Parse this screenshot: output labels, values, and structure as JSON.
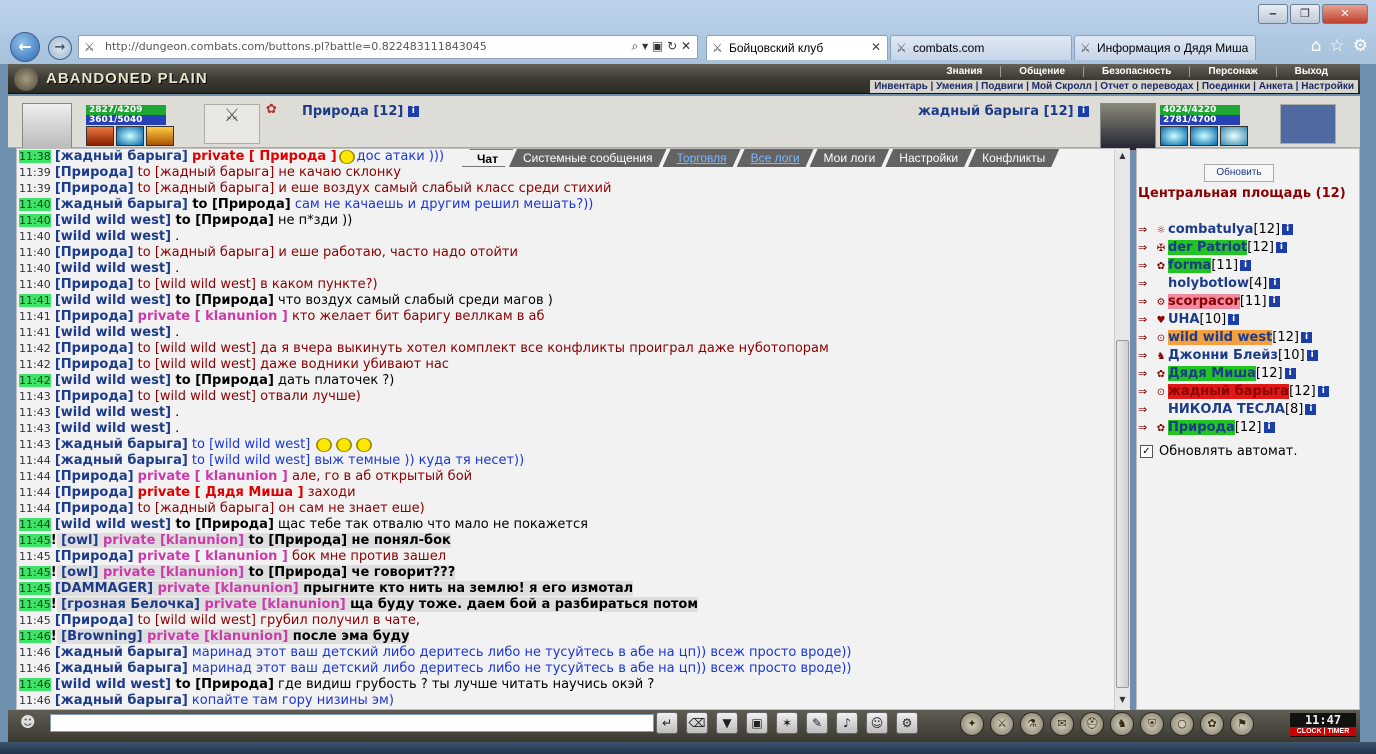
{
  "browser": {
    "url": "http://dungeon.combats.com/buttons.pl?battle=0.822483111843045",
    "tabs": [
      {
        "label": "Бойцовский клуб",
        "close": "✕"
      },
      {
        "label": "combats.com",
        "close": ""
      },
      {
        "label": "Информация о Дядя Миша",
        "close": ""
      }
    ],
    "window_buttons": [
      "‒",
      "❐",
      "✕"
    ]
  },
  "game": {
    "location_banner": "ABANDONED PLAIN",
    "top_menu": [
      "Знания",
      "Общение",
      "Безопасность",
      "Персонаж",
      "Выход"
    ],
    "sub_menu": "Инвентарь | Умения | Подвиги | Мой Скролл | Отчет о переводах | Поединки | Анкета | Настройки",
    "left_player": {
      "name": "Природа [12]",
      "hp": "2827/4209",
      "mana": "3601/5040"
    },
    "right_player": {
      "name": "жадный барыга [12]",
      "hp": "4024/4220",
      "mana": "2781/4700"
    }
  },
  "chat_tabs": [
    "Чат",
    "Системные сообщения",
    "Торговля",
    "Все логи",
    "Мои логи",
    "Настройки",
    "Конфликты"
  ],
  "chat": [
    {
      "ts": "11:38",
      "hl": true,
      "parts": [
        [
          "b",
          "[жадный барыга]"
        ],
        [
          "sp",
          " "
        ],
        [
          "pvr",
          "private [ Природа ]"
        ],
        [
          "sm",
          ""
        ],
        [
          "blue",
          "дос атаки )))"
        ]
      ]
    },
    {
      "ts": "11:39",
      "hl": false,
      "parts": [
        [
          "b",
          "[Природа]"
        ],
        [
          "to",
          " to [жадный барыга]"
        ],
        [
          "t",
          " не качаю склонку"
        ]
      ]
    },
    {
      "ts": "11:39",
      "hl": false,
      "parts": [
        [
          "b",
          "[Природа]"
        ],
        [
          "to",
          " to [жадный барыга]"
        ],
        [
          "t",
          " и еше воздух самый слабый класс среди стихий"
        ]
      ]
    },
    {
      "ts": "11:40",
      "hl": true,
      "parts": [
        [
          "b",
          "[жадный барыга]"
        ],
        [
          "bb",
          " to [Природа]"
        ],
        [
          "blue",
          " сам не качаешь и другим решил мешать?))"
        ]
      ]
    },
    {
      "ts": "11:40",
      "hl": true,
      "parts": [
        [
          "b",
          "[wild wild west]"
        ],
        [
          "bb",
          " to [Природа]"
        ],
        [
          "k",
          " не п*зди ))"
        ]
      ]
    },
    {
      "ts": "11:40",
      "hl": false,
      "parts": [
        [
          "b",
          "[wild wild west]"
        ],
        [
          "k",
          " ."
        ]
      ]
    },
    {
      "ts": "11:40",
      "hl": false,
      "parts": [
        [
          "b",
          "[Природа]"
        ],
        [
          "to",
          " to [жадный барыга]"
        ],
        [
          "t",
          " и еше работаю, часто надо отойти"
        ]
      ]
    },
    {
      "ts": "11:40",
      "hl": false,
      "parts": [
        [
          "b",
          "[wild wild west]"
        ],
        [
          "k",
          " ."
        ]
      ]
    },
    {
      "ts": "11:40",
      "hl": false,
      "parts": [
        [
          "b",
          "[Природа]"
        ],
        [
          "to",
          " to [wild wild west]"
        ],
        [
          "t",
          " в каком пункте?)"
        ]
      ]
    },
    {
      "ts": "11:41",
      "hl": true,
      "parts": [
        [
          "b",
          "[wild wild west]"
        ],
        [
          "bb",
          " to [Природа]"
        ],
        [
          "k",
          " что воздух самый слабый среди магов )"
        ]
      ]
    },
    {
      "ts": "11:41",
      "hl": false,
      "parts": [
        [
          "b",
          "[Природа]"
        ],
        [
          "sp",
          " "
        ],
        [
          "pv",
          "private [ klanunion ]"
        ],
        [
          "t",
          " кто желает бит баригу веллкам в аб"
        ]
      ]
    },
    {
      "ts": "11:41",
      "hl": false,
      "parts": [
        [
          "b",
          "[wild wild west]"
        ],
        [
          "k",
          " ."
        ]
      ]
    },
    {
      "ts": "11:42",
      "hl": false,
      "parts": [
        [
          "b",
          "[Природа]"
        ],
        [
          "to",
          " to [wild wild west]"
        ],
        [
          "t",
          " да я вчера выкинуть хотел комплект все конфликты проиграл даже нуботопорам"
        ]
      ]
    },
    {
      "ts": "11:42",
      "hl": false,
      "parts": [
        [
          "b",
          "[Природа]"
        ],
        [
          "to",
          " to [wild wild west]"
        ],
        [
          "t",
          " даже водники убивают нас"
        ]
      ]
    },
    {
      "ts": "11:42",
      "hl": true,
      "parts": [
        [
          "b",
          "[wild wild west]"
        ],
        [
          "bb",
          " to [Природа]"
        ],
        [
          "k",
          " дать платочек ?)"
        ]
      ]
    },
    {
      "ts": "11:43",
      "hl": false,
      "parts": [
        [
          "b",
          "[Природа]"
        ],
        [
          "to",
          " to [wild wild west]"
        ],
        [
          "t",
          " отвали лучше)"
        ]
      ]
    },
    {
      "ts": "11:43",
      "hl": false,
      "parts": [
        [
          "b",
          "[wild wild west]"
        ],
        [
          "k",
          " ."
        ]
      ]
    },
    {
      "ts": "11:43",
      "hl": false,
      "parts": [
        [
          "b",
          "[wild wild west]"
        ],
        [
          "k",
          " ."
        ]
      ]
    },
    {
      "ts": "11:43",
      "hl": false,
      "parts": [
        [
          "b",
          "[жадный барыга]"
        ],
        [
          "blue",
          " to [wild wild west] "
        ],
        [
          "sm",
          ""
        ],
        [
          "sm",
          ""
        ],
        [
          "sm",
          ""
        ]
      ]
    },
    {
      "ts": "11:44",
      "hl": false,
      "parts": [
        [
          "b",
          "[жадный барыга]"
        ],
        [
          "blue",
          " to [wild wild west] выж темные )) куда тя несет))"
        ]
      ]
    },
    {
      "ts": "11:44",
      "hl": false,
      "parts": [
        [
          "b",
          "[Природа]"
        ],
        [
          "sp",
          " "
        ],
        [
          "pv",
          "private [ klanunion ]"
        ],
        [
          "t",
          " але, го в аб открытый бой"
        ]
      ]
    },
    {
      "ts": "11:44",
      "hl": false,
      "parts": [
        [
          "b",
          "[Природа]"
        ],
        [
          "sp",
          " "
        ],
        [
          "pvr",
          "private [ Дядя Миша ]"
        ],
        [
          "t",
          " заходи"
        ]
      ]
    },
    {
      "ts": "11:44",
      "hl": false,
      "parts": [
        [
          "b",
          "[Природа]"
        ],
        [
          "to",
          " to [жадный барыга]"
        ],
        [
          "t",
          " он сам не знает еше)"
        ]
      ]
    },
    {
      "ts": "11:44",
      "hl": true,
      "parts": [
        [
          "b",
          "[wild wild west]"
        ],
        [
          "bb",
          " to [Природа]"
        ],
        [
          "k",
          " щас тебе так отвалю что мало не покажется"
        ]
      ]
    },
    {
      "ts": "11:45",
      "hl": true,
      "ex": "!",
      "parts": [
        [
          "gb",
          " [owl]"
        ],
        [
          "gpv",
          " private [klanunion]"
        ],
        [
          "gk",
          " to [Природа] не понял-бок"
        ]
      ]
    },
    {
      "ts": "11:45",
      "hl": false,
      "parts": [
        [
          "b",
          "[Природа]"
        ],
        [
          "sp",
          " "
        ],
        [
          "pv",
          "private [ klanunion ]"
        ],
        [
          "t",
          " бок мне против зашел"
        ]
      ]
    },
    {
      "ts": "11:45",
      "hl": true,
      "ex": "!",
      "parts": [
        [
          "gb",
          " [owl]"
        ],
        [
          "gpv",
          " private [klanunion]"
        ],
        [
          "gk",
          " to [Природа] че говорит???"
        ]
      ]
    },
    {
      "ts": "11:45",
      "hl": true,
      "parts": [
        [
          "gb",
          "[DAMMAGER]"
        ],
        [
          "gpv",
          " private [klanunion]"
        ],
        [
          "gk",
          " прыгните кто нить на землю! я его измотал"
        ]
      ]
    },
    {
      "ts": "11:45",
      "hl": true,
      "ex": "!",
      "parts": [
        [
          "gb",
          " [грозная Белочка]"
        ],
        [
          "gpv",
          " private [klanunion]"
        ],
        [
          "gk",
          " ща буду тоже. даем бой а разбираться потом"
        ]
      ]
    },
    {
      "ts": "11:45",
      "hl": false,
      "parts": [
        [
          "b",
          "[Природа]"
        ],
        [
          "to",
          " to [wild wild west]"
        ],
        [
          "t",
          " грубил получил в чате,"
        ]
      ]
    },
    {
      "ts": "11:46",
      "hl": true,
      "ex": "!",
      "parts": [
        [
          "gb",
          " [Browning]"
        ],
        [
          "gpv",
          " private [klanunion]"
        ],
        [
          "gk",
          " после эма буду"
        ]
      ]
    },
    {
      "ts": "11:46",
      "hl": false,
      "parts": [
        [
          "b",
          "[жадный барыга]"
        ],
        [
          "blue",
          " маринад этот ваш детский либо деритесь либо не тусуйтесь в абе на цп)) всеж просто вроде))"
        ]
      ]
    },
    {
      "ts": "11:46",
      "hl": false,
      "parts": [
        [
          "b",
          "[жадный барыга]"
        ],
        [
          "blue",
          " маринад этот ваш детский либо деритесь либо не тусуйтесь в абе на цп)) всеж просто вроде))"
        ]
      ]
    },
    {
      "ts": "11:46",
      "hl": true,
      "parts": [
        [
          "b",
          "[wild wild west]"
        ],
        [
          "bb",
          " to [Природа]"
        ],
        [
          "k",
          " где видиш грубость ? ты лучше читать научись окэй ?"
        ]
      ]
    },
    {
      "ts": "11:46",
      "hl": false,
      "parts": [
        [
          "b",
          "[жадный барыга]"
        ],
        [
          "blue",
          " копайте там гору низины эм)"
        ]
      ]
    }
  ],
  "right_panel": {
    "refresh_label": "Обновить",
    "location": "Центральная площадь (12)",
    "users": [
      {
        "name": "combatulya",
        "level": "[12]",
        "style": ""
      },
      {
        "name": "der Patriot",
        "level": "[12]",
        "style": "green"
      },
      {
        "name": "forma",
        "level": "[11]",
        "style": "green"
      },
      {
        "name": "holybotlow",
        "level": "[4]",
        "style": ""
      },
      {
        "name": "scorpacor",
        "level": "[11]",
        "style": "pink"
      },
      {
        "name": "UHA",
        "level": "[10]",
        "style": ""
      },
      {
        "name": "wild wild west",
        "level": "[12]",
        "style": "orange"
      },
      {
        "name": "Джонни Блейз",
        "level": "[10]",
        "style": ""
      },
      {
        "name": "Дядя Миша",
        "level": "[12]",
        "style": "green"
      },
      {
        "name": "жадный барыга",
        "level": "[12]",
        "style": "red"
      },
      {
        "name": "НИКОЛА ТЕСЛА",
        "level": "[8]",
        "style": ""
      },
      {
        "name": "Природа",
        "level": "[12]",
        "style": "green"
      }
    ],
    "auto_refresh_label": "Обновлять автомат."
  },
  "clock": {
    "time": "11:47",
    "label": "CLOCK | TIMER"
  },
  "colors": {
    "highlight_ts": "#3fe36a",
    "private": "#cc3aac",
    "nick": "#1c3b8a"
  }
}
